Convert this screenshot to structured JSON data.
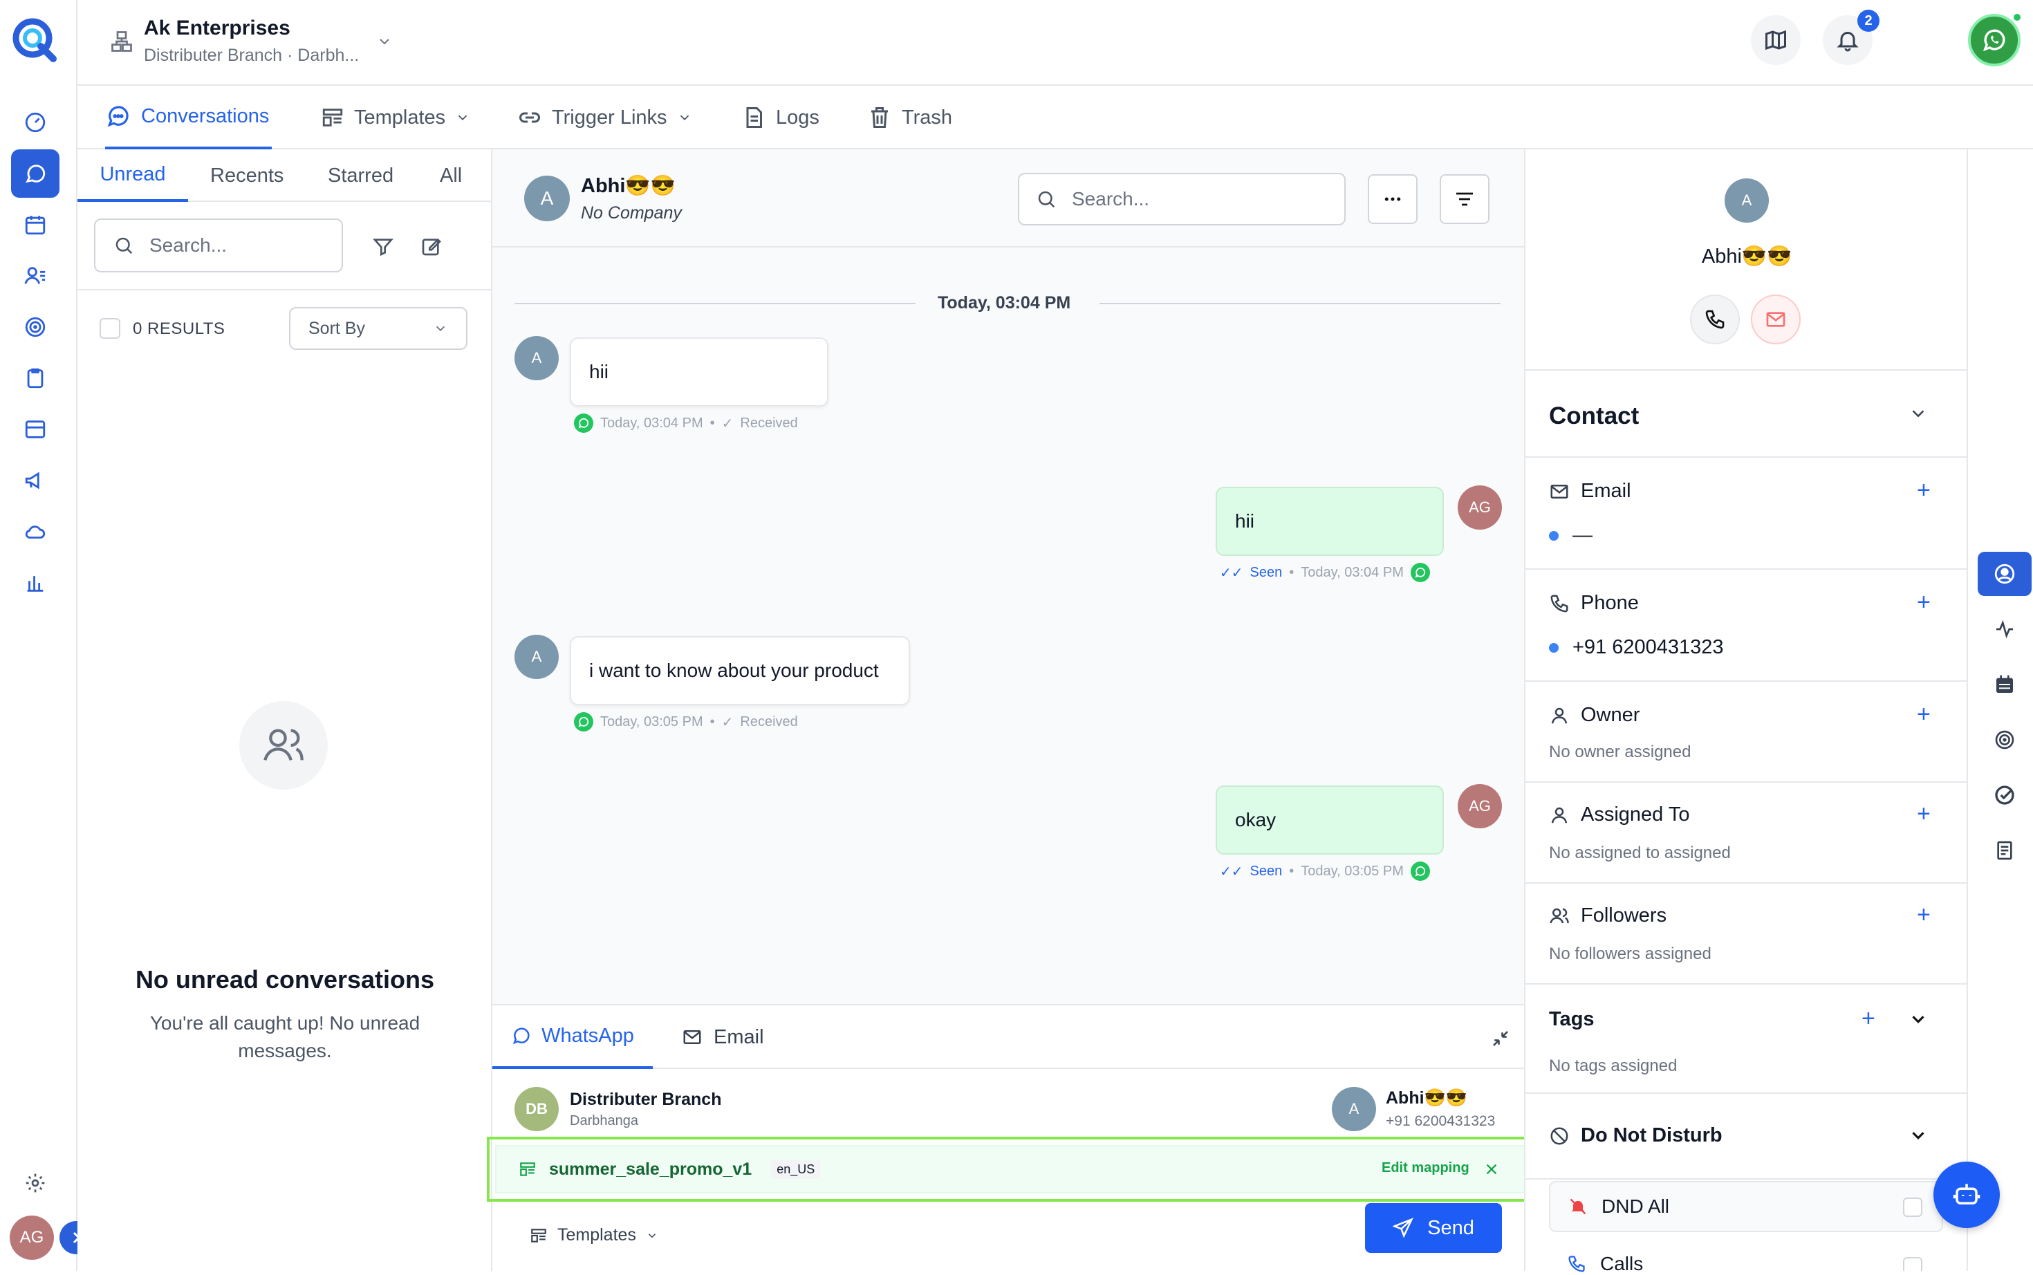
{
  "org": {
    "name": "Ak Enterprises",
    "branch": "Distributer Branch · Darbh..."
  },
  "header": {
    "notification_count": "2",
    "user_initials": "AG"
  },
  "top_tabs": [
    {
      "label": "Conversations"
    },
    {
      "label": "Templates"
    },
    {
      "label": "Trigger Links"
    },
    {
      "label": "Logs"
    },
    {
      "label": "Trash"
    }
  ],
  "list": {
    "subtabs": [
      "Unread",
      "Recents",
      "Starred",
      "All"
    ],
    "search_placeholder": "Search...",
    "results": "0 RESULTS",
    "sort_label": "Sort By",
    "empty_title": "No unread conversations",
    "empty_line1": "You're all caught up! No unread",
    "empty_line2": "messages."
  },
  "chat": {
    "contact_initial": "A",
    "contact_name": "Abhi😎😎",
    "contact_company": "No Company",
    "search_placeholder": "Search...",
    "date_divider": "Today, 03:04 PM",
    "messages": [
      {
        "text": "hii",
        "meta_time": "Today, 03:04 PM",
        "status": "Received",
        "avatar": "A"
      },
      {
        "text": "hii",
        "meta_time": "Today, 03:04 PM",
        "status": "Seen",
        "avatar": "AG"
      },
      {
        "text": "i want to know about your product",
        "meta_time": "Today, 03:05 PM",
        "status": "Received",
        "avatar": "A"
      },
      {
        "text": "okay",
        "meta_time": "Today, 03:05 PM",
        "status": "Seen",
        "avatar": "AG"
      }
    ],
    "separator": "•"
  },
  "composer": {
    "tabs": [
      "WhatsApp",
      "Email"
    ],
    "from_initials": "DB",
    "from_name": "Distributer Branch",
    "from_sub": "Darbhanga",
    "to_initial": "A",
    "to_name": "Abhi😎😎",
    "to_phone": "+91 6200431323",
    "template_name": "summer_sale_promo_v1",
    "template_lang": "en_US",
    "edit_mapping": "Edit mapping",
    "templates_label": "Templates",
    "send_label": "Send"
  },
  "contact": {
    "initial": "A",
    "name": "Abhi😎😎",
    "section_title": "Contact",
    "email_label": "Email",
    "email_value": "—",
    "phone_label": "Phone",
    "phone_value": "+91 6200431323",
    "owner_label": "Owner",
    "owner_value": "No owner assigned",
    "assigned_label": "Assigned To",
    "assigned_value": "No assigned to assigned",
    "followers_label": "Followers",
    "followers_value": "No followers assigned",
    "tags_label": "Tags",
    "tags_value": "No tags assigned",
    "dnd_label": "Do Not Disturb",
    "dnd_all": "DND All",
    "calls": "Calls"
  },
  "colors": {
    "accent": "#2563eb",
    "whatsapp": "#22c55e",
    "highlight": "#84e84a"
  }
}
